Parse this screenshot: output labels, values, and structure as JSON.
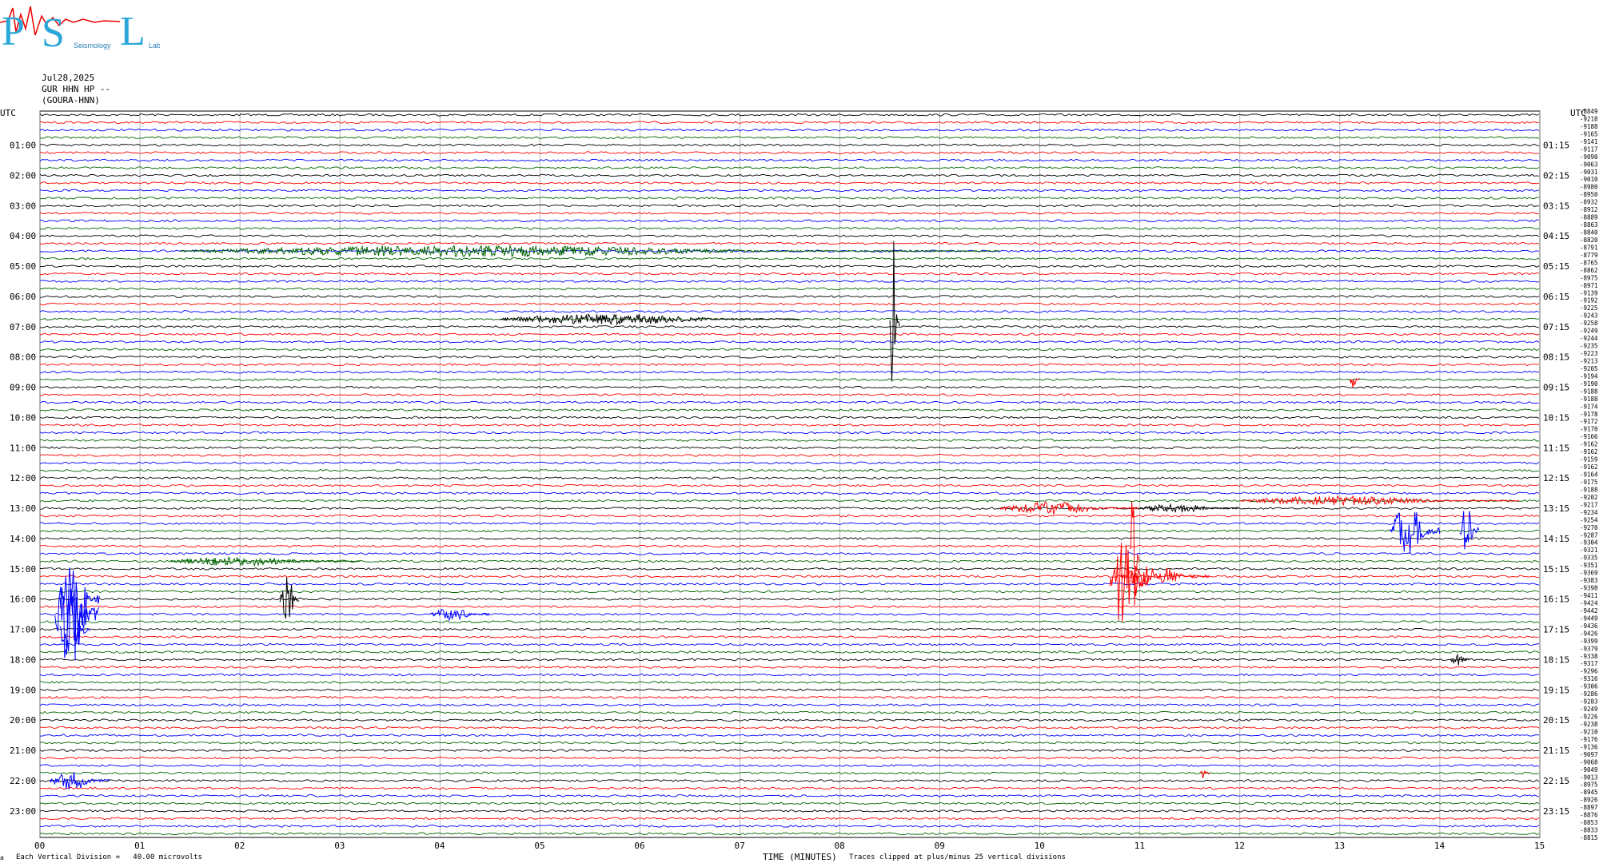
{
  "logo": {
    "letters": [
      "P",
      "S",
      "L"
    ],
    "words": [
      "Seismology",
      "Lab"
    ]
  },
  "header": {
    "date": "Jul28,2025",
    "station": "GUR HHN HP --",
    "site": "(GOURA-HNN)"
  },
  "axis": {
    "utc_label_left": "UTC",
    "utc_label_right": "UTC",
    "xlabel": "TIME (MINUTES)",
    "x_ticks": [
      "00",
      "01",
      "02",
      "03",
      "04",
      "05",
      "06",
      "07",
      "08",
      "09",
      "10",
      "11",
      "12",
      "13",
      "14",
      "15"
    ],
    "left_hours": [
      "01:00",
      "02:00",
      "03:00",
      "04:00",
      "05:00",
      "06:00",
      "07:00",
      "08:00",
      "09:00",
      "10:00",
      "11:00",
      "12:00",
      "13:00",
      "14:00",
      "15:00",
      "16:00",
      "17:00",
      "18:00",
      "19:00",
      "20:00",
      "21:00",
      "22:00",
      "23:00"
    ],
    "right_hours": [
      "01:15",
      "02:15",
      "03:15",
      "04:15",
      "05:15",
      "06:15",
      "07:15",
      "08:15",
      "09:15",
      "10:15",
      "11:15",
      "12:15",
      "13:15",
      "14:15",
      "15:15",
      "16:15",
      "17:15",
      "18:15",
      "19:15",
      "20:15",
      "21:15",
      "22:15",
      "23:15"
    ]
  },
  "footer": {
    "division": "Each Vertical Division =   40.00 microvolts",
    "clip_note": "Traces clipped at plus/minus 25 vertical divisions"
  },
  "chart_data": {
    "type": "line",
    "title": "",
    "xlabel": "TIME (MINUTES)",
    "xlim": [
      0,
      15
    ],
    "trace_colors": [
      "#000000",
      "#ff0000",
      "#0000ff",
      "#006400"
    ],
    "trace_count": 96,
    "trace_interval_minutes": 15,
    "right_offsets": [
      "-8849",
      "-9218",
      "-9188",
      "-9165",
      "-9141",
      "-9117",
      "-9090",
      "-9063",
      "-9031",
      "-9010",
      "-8980",
      "-8950",
      "-8932",
      "-8912",
      "-8889",
      "-8863",
      "-8840",
      "-8820",
      "-8791",
      "-8779",
      "-8765",
      "-8862",
      "-8975",
      "-8971",
      "-9139",
      "-9192",
      "-9225",
      "-9243",
      "-9258",
      "-9249",
      "-9244",
      "-9235",
      "-9223",
      "-9213",
      "-9205",
      "-9194",
      "-9190",
      "-9188",
      "-9188",
      "-9174",
      "-9178",
      "-9172",
      "-9170",
      "-9166",
      "-9162",
      "-9162",
      "-9159",
      "-9162",
      "-9164",
      "-9175",
      "-9188",
      "-9202",
      "-9217",
      "-9234",
      "-9254",
      "-9270",
      "-9287",
      "-9304",
      "-9321",
      "-9335",
      "-9351",
      "-9369",
      "-9383",
      "-9398",
      "-9411",
      "-9424",
      "-9442",
      "-9449",
      "-9436",
      "-9426",
      "-9399",
      "-9379",
      "-9338",
      "-9317",
      "-9296",
      "-9316",
      "-9306",
      "-9286",
      "-9283",
      "-9249",
      "-9226",
      "-9238",
      "-9210",
      "-9176",
      "-9136",
      "-9097",
      "-9068",
      "-9049",
      "-9013",
      "-8975",
      "-8945",
      "-8926",
      "-8897",
      "-8876",
      "-8853",
      "-8833",
      "-8815"
    ],
    "events": [
      {
        "trace": 88,
        "start_min": 0.1,
        "end_min": 0.7,
        "amp": 10,
        "color": "#0000ff"
      },
      {
        "trace": 64,
        "start_min": 0.2,
        "end_min": 0.6,
        "amp": 48,
        "color": "#0000ff"
      },
      {
        "trace": 66,
        "start_min": 0.15,
        "end_min": 0.6,
        "amp": 60,
        "color": "#0000ff"
      },
      {
        "trace": 68,
        "start_min": 0.2,
        "end_min": 0.5,
        "amp": 40,
        "color": "#0000ff"
      },
      {
        "trace": 64,
        "start_min": 2.4,
        "end_min": 2.6,
        "amp": 25,
        "color": "#000000"
      },
      {
        "trace": 59,
        "start_min": 1.3,
        "end_min": 3.2,
        "amp": 5,
        "color": "#006400"
      },
      {
        "trace": 66,
        "start_min": 3.9,
        "end_min": 4.5,
        "amp": 7,
        "color": "#0000ff"
      },
      {
        "trace": 18,
        "start_min": 1.4,
        "end_min": 9.6,
        "amp": 6,
        "color": "#006400"
      },
      {
        "trace": 27,
        "start_min": 4.6,
        "end_min": 7.6,
        "amp": 6,
        "color": "#000000"
      },
      {
        "trace": 27,
        "start_min": 8.5,
        "end_min": 8.6,
        "amp": 90,
        "color": "#000000"
      },
      {
        "trace": 61,
        "start_min": 10.8,
        "end_min": 11.7,
        "amp": 12,
        "color": "#ff0000"
      },
      {
        "trace": 62,
        "start_min": 10.7,
        "end_min": 11.1,
        "amp": 55,
        "color": "#ff0000"
      },
      {
        "trace": 58,
        "start_min": 10.9,
        "end_min": 11.0,
        "amp": 80,
        "color": "#ff0000"
      },
      {
        "trace": 52,
        "start_min": 9.6,
        "end_min": 11.0,
        "amp": 7,
        "color": "#ff0000"
      },
      {
        "trace": 52,
        "start_min": 11.0,
        "end_min": 12.0,
        "amp": 5,
        "color": "#000000"
      },
      {
        "trace": 55,
        "start_min": 13.5,
        "end_min": 14.0,
        "amp": 30,
        "color": "#0000ff"
      },
      {
        "trace": 55,
        "start_min": 14.2,
        "end_min": 14.4,
        "amp": 28,
        "color": "#0000ff"
      },
      {
        "trace": 35,
        "start_min": 13.1,
        "end_min": 13.2,
        "amp": 12,
        "color": "#ff0000"
      },
      {
        "trace": 72,
        "start_min": 14.1,
        "end_min": 14.3,
        "amp": 7,
        "color": "#000000"
      },
      {
        "trace": 87,
        "start_min": 11.6,
        "end_min": 11.7,
        "amp": 7,
        "color": "#ff0000"
      },
      {
        "trace": 51,
        "start_min": 12.0,
        "end_min": 14.8,
        "amp": 5,
        "color": "#ff0000"
      }
    ]
  }
}
